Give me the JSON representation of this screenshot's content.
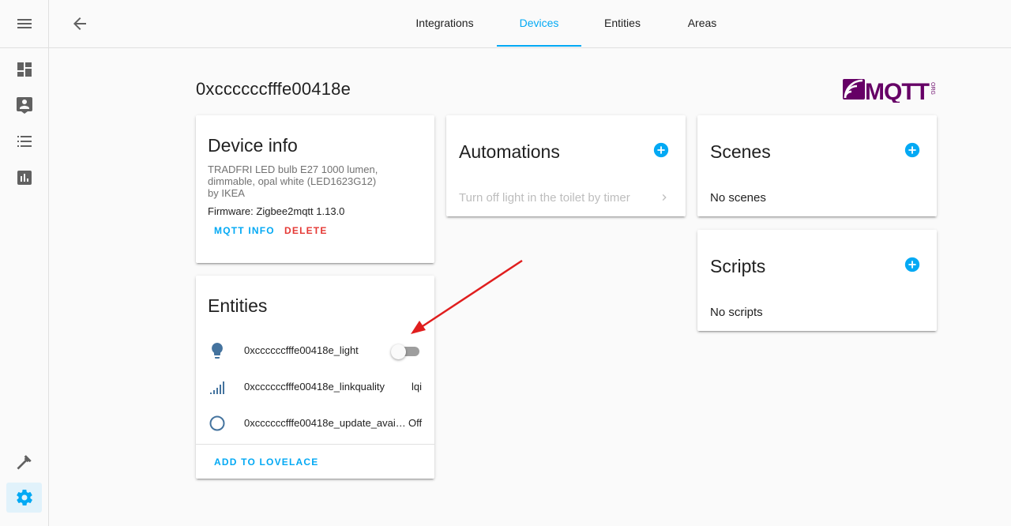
{
  "sidebar": {
    "items": [
      {
        "icon": "menu-icon"
      },
      {
        "icon": "dashboard-icon"
      },
      {
        "icon": "map-marker-icon"
      },
      {
        "icon": "logbook-icon"
      },
      {
        "icon": "history-icon"
      },
      {
        "icon": "developer-tools-icon"
      },
      {
        "icon": "settings-icon"
      }
    ],
    "accent": "#03a9f4"
  },
  "header": {
    "tabs": [
      {
        "label": "Integrations",
        "active": false
      },
      {
        "label": "Devices",
        "active": true
      },
      {
        "label": "Entities",
        "active": false
      },
      {
        "label": "Areas",
        "active": false
      }
    ]
  },
  "device": {
    "title": "0xccccccfffe00418e",
    "logo": {
      "text": "MQTT",
      "sub": "ORG"
    }
  },
  "device_info": {
    "title": "Device info",
    "description_line1": "TRADFRI LED bulb E27 1000 lumen,",
    "description_line2": "dimmable, opal white (LED1623G12)",
    "manufacturer": "by IKEA",
    "firmware": "Firmware: Zigbee2mqtt 1.13.0",
    "mqtt_info_label": "MQTT INFO",
    "delete_label": "DELETE"
  },
  "entities": {
    "title": "Entities",
    "rows": [
      {
        "icon": "lightbulb-icon",
        "name": "0xccccccfffe00418e_light",
        "state": "",
        "toggle": false
      },
      {
        "icon": "signal-icon",
        "name": "0xccccccfffe00418e_linkquality",
        "state": "lqi"
      },
      {
        "icon": "circle-outline-icon",
        "name": "0xccccccfffe00418e_update_avai…",
        "state": "Off"
      }
    ],
    "add_to_lovelace_label": "ADD TO LOVELACE"
  },
  "automations": {
    "title": "Automations",
    "items": [
      {
        "label": "Turn off light in the toilet by timer"
      }
    ]
  },
  "scenes": {
    "title": "Scenes",
    "empty": "No scenes"
  },
  "scripts": {
    "title": "Scripts",
    "empty": "No scripts"
  },
  "colors": {
    "accent": "#03a9f4",
    "delete": "#e53935",
    "entity_icon": "#44739e",
    "arrow": "#e01e1e"
  }
}
